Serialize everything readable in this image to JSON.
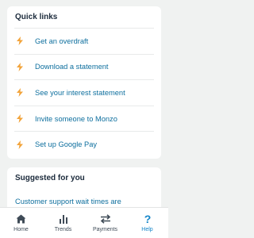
{
  "quick_links": {
    "title": "Quick links",
    "items": [
      {
        "label": "Get an overdraft",
        "icon": "bolt-icon"
      },
      {
        "label": "Download a statement",
        "icon": "bolt-icon"
      },
      {
        "label": "See your interest statement",
        "icon": "bolt-icon"
      },
      {
        "label": "Invite someone to Monzo",
        "icon": "bolt-icon"
      },
      {
        "label": "Set up Google Pay",
        "icon": "bolt-icon"
      }
    ]
  },
  "suggested": {
    "title": "Suggested for you",
    "text": "Customer support wait times are"
  },
  "tabbar": {
    "tabs": [
      {
        "label": "Home",
        "icon": "home-icon"
      },
      {
        "label": "Trends",
        "icon": "trends-icon"
      },
      {
        "label": "Payments",
        "icon": "payments-icon"
      },
      {
        "label": "Help",
        "icon": "help-icon",
        "active": true
      }
    ]
  },
  "colors": {
    "accent": "#1385c8",
    "link": "#0e6f9e",
    "bolt": "#f2a33a",
    "background": "#f0f2f1"
  }
}
